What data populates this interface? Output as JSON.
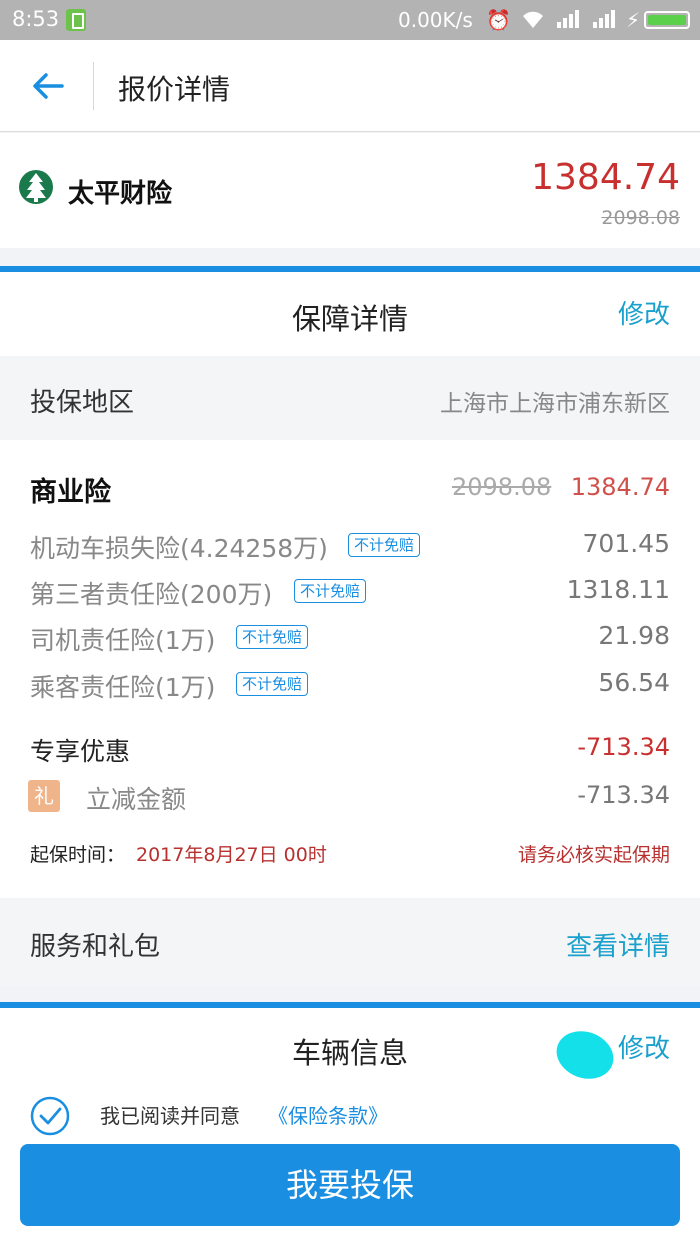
{
  "status_bar": {
    "time": "8:53",
    "network_speed": "0.00K/s",
    "icons": [
      "battery-saver-icon",
      "alarm-icon",
      "wifi-icon",
      "signal-icon",
      "signal-icon",
      "charging-icon",
      "battery-icon"
    ]
  },
  "header": {
    "title": "报价详情",
    "back_icon": "back-arrow-icon"
  },
  "company": {
    "name": "太平财险",
    "logo_icon": "pine-tree-logo",
    "price_current": "1384.74",
    "price_original": "2098.08"
  },
  "coverage": {
    "title": "保障详情",
    "edit_label": "修改",
    "region_label": "投保地区",
    "region_value": "上海市上海市浦东新区",
    "commercial": {
      "title": "商业险",
      "price_original": "2098.08",
      "price_current": "1384.74",
      "items": [
        {
          "name": "机动车损失险(4.24258万)",
          "badge": "不计免赔",
          "price": "701.45"
        },
        {
          "name": "第三者责任险(200万)",
          "badge": "不计免赔",
          "price": "1318.11"
        },
        {
          "name": "司机责任险(1万)",
          "badge": "不计免赔",
          "price": "21.98"
        },
        {
          "name": "乘客责任险(1万)",
          "badge": "不计免赔",
          "price": "56.54"
        }
      ]
    },
    "promo": {
      "title": "专享优惠",
      "total": "-713.34",
      "gift_icon_text": "礼",
      "gift_label": "立减金额",
      "gift_value": "-713.34"
    },
    "start": {
      "label": "起保时间：",
      "date": "2017年8月27日 00时",
      "note": "请务必核实起保期"
    }
  },
  "services": {
    "label": "服务和礼包",
    "link": "查看详情"
  },
  "vehicle": {
    "title": "车辆信息",
    "edit_label": "修改"
  },
  "agreement": {
    "text": "我已阅读并同意",
    "link": "《保险条款》"
  },
  "submit": {
    "label": "我要投保"
  },
  "colors": {
    "accent_blue": "#1a8ee1",
    "price_red": "#c8302f",
    "link_cyan": "#1aa0cc"
  }
}
